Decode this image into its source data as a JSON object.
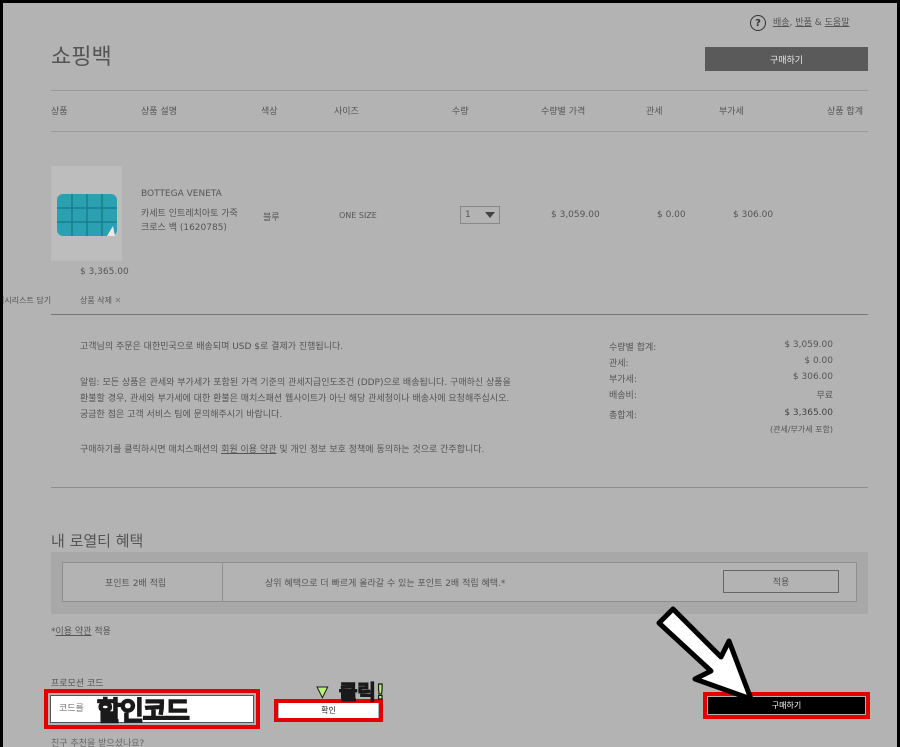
{
  "help": {
    "icon": "?",
    "links": [
      "배송",
      "반품",
      "도움말"
    ],
    "sep1": ",",
    "sep2": "&"
  },
  "title": "쇼핑백",
  "top_buy_label": "구매하기",
  "columns": [
    "상품",
    "상품 설명",
    "색상",
    "사이즈",
    "수량",
    "수량별 가격",
    "관세",
    "부가세",
    "상품 합계"
  ],
  "item": {
    "brand": "BOTTEGA VENETA",
    "name_line1": "카세트 인트레치아토 가죽",
    "name_line2": "크로스 백 (1620785)",
    "color": "블루",
    "size": "ONE SIZE",
    "qty": "1",
    "price": "$ 3,059.00",
    "duty": "$ 0.00",
    "vat": "$ 306.00",
    "total": "$ 3,365.00",
    "wishlist": "위시리스트 담기",
    "delete": "상품 삭제",
    "image_color": "#2aa0b0"
  },
  "notice": {
    "p1": "고객님의 주문은 대한민국으로 배송되며 USD $로 결제가 진행됩니다.",
    "p2_l1": "알림: 모든 상품은 관세와 부가세가 포함된 가격 기준의 관세지급인도조건 (DDP)으로 배송됩니다. 구매하신 상품을",
    "p2_l2": "환불할 경우, 관세와 부가세에 대한 환불은 매치스패션 웹사이트가 아닌 해당 관세청이나 배송사에 요청해주십시오.",
    "p2_l3": "궁금한 점은 고객 서비스 팀에 문의해주시기 바랍니다.",
    "p3_a": "구매하기를 클릭하시면 매치스패션의 ",
    "p3_link": "회원 이용 약관",
    "p3_b": " 및 개인 정보 보호 정책에 동의하는 것으로 간주합니다."
  },
  "summary": {
    "subtotal_label": "수량별 합계:",
    "subtotal": "$ 3,059.00",
    "duty_label": "관세:",
    "duty": "$ 0.00",
    "vat_label": "부가세:",
    "vat": "$ 306.00",
    "shipping_label": "배송비:",
    "shipping": "무료",
    "grand_label": "총합계:",
    "grand": "$ 3,365.00",
    "grand_note": "(관세/부가세 포함)"
  },
  "loyalty": {
    "title": "내 로열티 혜택",
    "name": "포인트 2배 적립",
    "desc": "상위 혜택으로 더 빠르게 올라갈 수 있는 포인트 2배 적립 혜택.*",
    "apply": "적용",
    "terms_prefix": "*",
    "terms_link": "이용 약관",
    "terms_suffix": " 적용"
  },
  "promo": {
    "label": "프로모션 코드",
    "placeholder": "코드를",
    "overlay": "할인코드",
    "confirm": "확인",
    "click_hint": "클릭!",
    "arrow": "▼",
    "referral": "친구 추천을 받으셨나요?"
  },
  "bottom_buy_label": "구매하기",
  "colors": {
    "highlight_red": "#e30000",
    "dark_button": "#5a5a5a",
    "black_button": "#000000",
    "overlay_green": "#b8f27a"
  }
}
